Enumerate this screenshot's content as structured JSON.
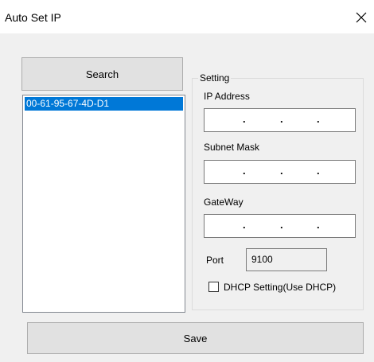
{
  "window": {
    "title": "Auto Set IP"
  },
  "icons": {
    "close": "close-icon"
  },
  "search_button": {
    "label": "Search"
  },
  "device_list": {
    "items": [
      "00-61-95-67-4D-D1"
    ],
    "selected_index": 0
  },
  "setting_group": {
    "title": "Setting",
    "ip_address": {
      "label": "IP Address",
      "value": "",
      "dots": [
        ".",
        ".",
        "."
      ]
    },
    "subnet_mask": {
      "label": "Subnet Mask",
      "value": "",
      "dots": [
        ".",
        ".",
        "."
      ]
    },
    "gateway": {
      "label": "GateWay",
      "value": "",
      "dots": [
        ".",
        ".",
        "."
      ]
    },
    "port": {
      "label": "Port",
      "value": "9100"
    },
    "dhcp": {
      "label": "DHCP Setting(Use DHCP)",
      "checked": false
    }
  },
  "save_button": {
    "label": "Save"
  },
  "colors": {
    "selection": "#0078d7",
    "window_bg": "#f0f0f0",
    "button_bg": "#e1e1e1"
  }
}
